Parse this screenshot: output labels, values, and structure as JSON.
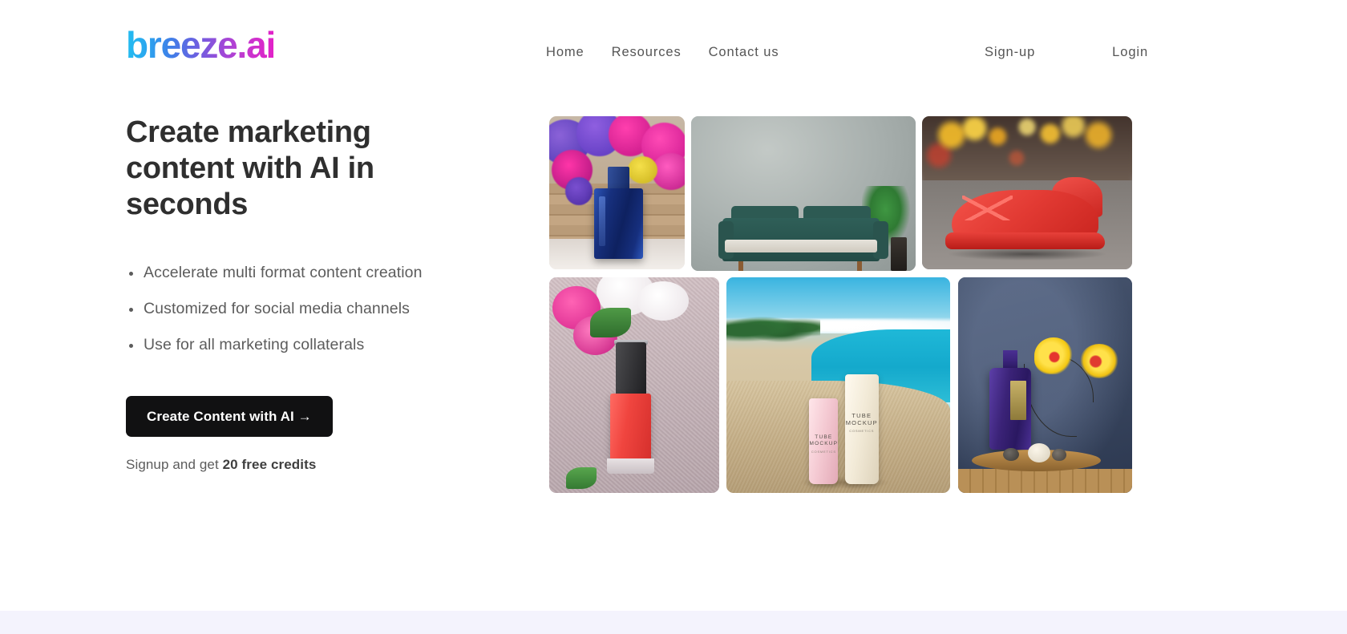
{
  "brand": {
    "logo_text": "breeze.ai",
    "gradient_start": "#22bdf0",
    "gradient_end": "#e320c8"
  },
  "nav": {
    "main_links": [
      {
        "label": "Home"
      },
      {
        "label": "Resources"
      },
      {
        "label": "Contact us"
      }
    ],
    "auth_links": [
      {
        "label": "Sign-up"
      },
      {
        "label": "Login"
      }
    ]
  },
  "hero": {
    "title": "Create marketing content with AI in seconds",
    "bullets": [
      "Accelerate multi format content creation",
      "Customized for social media channels",
      "Use for all marketing collaterals"
    ],
    "cta_label": "Create Content with AI →",
    "cta_sub_prefix": "Signup and get ",
    "cta_sub_bold": "20 free credits",
    "cta_bg_color": "#111112",
    "cta_text_color": "#ffffff"
  },
  "gallery": {
    "tiles": [
      {
        "name": "blue-perfume-bottle-with-flowers",
        "alt": "Blue perfume bottle on wooden crate surrounded by pink and purple flowers"
      },
      {
        "name": "teal-sofa-in-gray-room",
        "alt": "Dark teal velvet sofa against a gray wall with a potted plant"
      },
      {
        "name": "red-sneaker-on-street",
        "alt": "Red high-top sneaker on pavement with bokeh city lights"
      },
      {
        "name": "red-nail-polish-with-flowers",
        "alt": "Coral red nail polish bottle on textured cloth with pink flowers"
      },
      {
        "name": "cosmetic-tubes-on-beach",
        "alt": "Pink and cream cosmetic tube mockups on a tropical beach"
      },
      {
        "name": "purple-bottle-with-orchid",
        "alt": "Purple glass bottle with yellow orchid on a wooden board"
      }
    ],
    "tube_mockup": {
      "pink_line1": "TUBE",
      "pink_line2": "MOCKUP",
      "pink_sub": "COSMETICS",
      "cream_line1": "TUBE",
      "cream_line2": "MOCKUP",
      "cream_sub": "COSMETICS"
    }
  },
  "footer": {
    "band_color": "#f4f3fd"
  }
}
